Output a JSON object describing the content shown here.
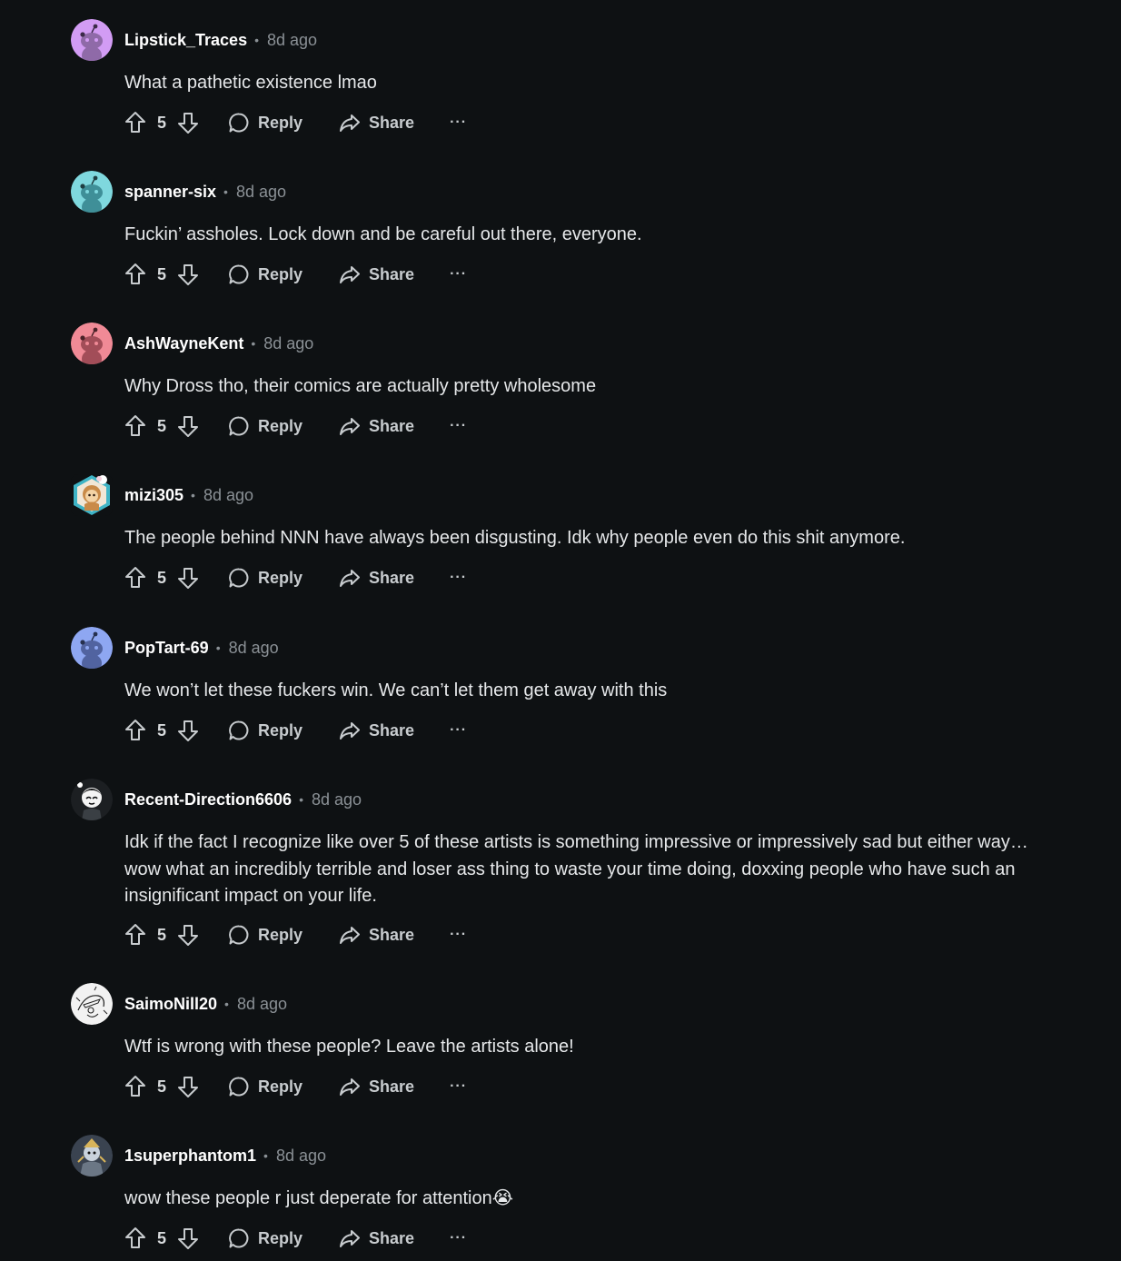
{
  "comments": [
    {
      "username": "Lipstick_Traces",
      "time": "8d ago",
      "text": "What a pathetic existence lmao",
      "score": "5",
      "avatar_color": "#d29cf4",
      "avatar": "snoo-avatar"
    },
    {
      "username": "spanner-six",
      "time": "8d ago",
      "text": "Fuckin’ assholes. Lock down and be careful out there, everyone.",
      "score": "5",
      "avatar_color": "#7fd8de",
      "avatar": "snoo-avatar"
    },
    {
      "username": "AshWayneKent",
      "time": "8d ago",
      "text": "Why Dross tho, their comics are actually pretty wholesome",
      "score": "5",
      "avatar_color": "#f08a96",
      "avatar": "snoo-avatar"
    },
    {
      "username": "mizi305",
      "time": "8d ago",
      "text": "The people behind NNN have always been disgusting. Idk why people even do this shit anymore.",
      "score": "5",
      "avatar_color": "#46b8c8",
      "avatar": "custom-character-avatar"
    },
    {
      "username": "PopTart-69",
      "time": "8d ago",
      "text": "We won’t let these fuckers win. We can’t let them get away with this",
      "score": "5",
      "avatar_color": "#8ea7f2",
      "avatar": "snoo-avatar"
    },
    {
      "username": "Recent-Direction6606",
      "time": "8d ago",
      "text": "Idk if the fact I recognize like over 5 of these artists is something impressive or impressively sad but either way… wow what an incredibly terrible and loser ass thing to waste your time doing, doxxing people who have such an insignificant impact on your life.",
      "score": "5",
      "avatar_color": "#1c1f22",
      "avatar": "custom-character-avatar"
    },
    {
      "username": "SaimoNill20",
      "time": "8d ago",
      "text": "Wtf is wrong with these people? Leave the artists alone!",
      "score": "5",
      "avatar_color": "#f2f2f2",
      "avatar": "sketch-drawing-avatar"
    },
    {
      "username": "1superphantom1",
      "time": "8d ago",
      "text": "wow these people r just deperate for attention😭",
      "score": "5",
      "avatar_color": "#3a4350",
      "avatar": "custom-character-avatar"
    }
  ],
  "actions": {
    "reply_label": "Reply",
    "share_label": "Share",
    "more_label": "···"
  },
  "colors": {
    "background": "#0e1113",
    "text": "#e6e8ea",
    "muted": "#8b9196"
  }
}
